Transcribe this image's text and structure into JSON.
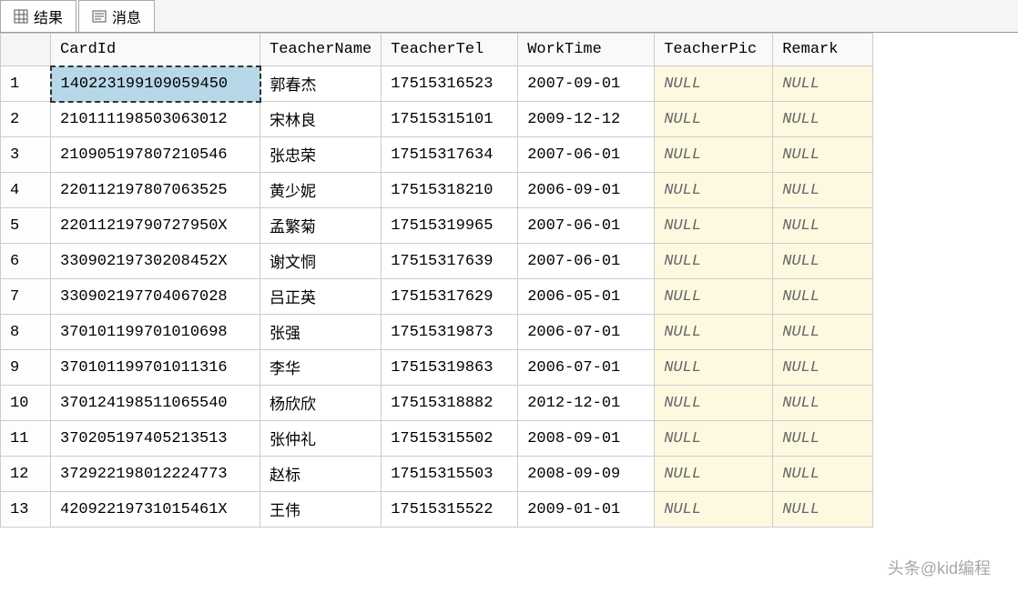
{
  "tabs": {
    "results": "结果",
    "messages": "消息"
  },
  "columns": {
    "cardId": "CardId",
    "teacherName": "TeacherName",
    "teacherTel": "TeacherTel",
    "workTime": "WorkTime",
    "teacherPic": "TeacherPic",
    "remark": "Remark"
  },
  "nullText": "NULL",
  "rows": [
    {
      "num": "1",
      "cardId": "140223199109059450",
      "teacherName": "郭春杰",
      "teacherTel": "17515316523",
      "workTime": "2007-09-01",
      "teacherPic": null,
      "remark": null
    },
    {
      "num": "2",
      "cardId": "210111198503063012",
      "teacherName": "宋林良",
      "teacherTel": "17515315101",
      "workTime": "2009-12-12",
      "teacherPic": null,
      "remark": null
    },
    {
      "num": "3",
      "cardId": "210905197807210546",
      "teacherName": "张忠荣",
      "teacherTel": "17515317634",
      "workTime": "2007-06-01",
      "teacherPic": null,
      "remark": null
    },
    {
      "num": "4",
      "cardId": "220112197807063525",
      "teacherName": "黄少妮",
      "teacherTel": "17515318210",
      "workTime": "2006-09-01",
      "teacherPic": null,
      "remark": null
    },
    {
      "num": "5",
      "cardId": "22011219790727950X",
      "teacherName": "孟繁菊",
      "teacherTel": "17515319965",
      "workTime": "2007-06-01",
      "teacherPic": null,
      "remark": null
    },
    {
      "num": "6",
      "cardId": "33090219730208452X",
      "teacherName": "谢文恫",
      "teacherTel": "17515317639",
      "workTime": "2007-06-01",
      "teacherPic": null,
      "remark": null
    },
    {
      "num": "7",
      "cardId": "330902197704067028",
      "teacherName": "吕正英",
      "teacherTel": "17515317629",
      "workTime": "2006-05-01",
      "teacherPic": null,
      "remark": null
    },
    {
      "num": "8",
      "cardId": "370101199701010698",
      "teacherName": "张强",
      "teacherTel": "17515319873",
      "workTime": "2006-07-01",
      "teacherPic": null,
      "remark": null
    },
    {
      "num": "9",
      "cardId": "370101199701011316",
      "teacherName": "李华",
      "teacherTel": "17515319863",
      "workTime": "2006-07-01",
      "teacherPic": null,
      "remark": null
    },
    {
      "num": "10",
      "cardId": "370124198511065540",
      "teacherName": "杨欣欣",
      "teacherTel": "17515318882",
      "workTime": "2012-12-01",
      "teacherPic": null,
      "remark": null
    },
    {
      "num": "11",
      "cardId": "370205197405213513",
      "teacherName": "张仲礼",
      "teacherTel": "17515315502",
      "workTime": "2008-09-01",
      "teacherPic": null,
      "remark": null
    },
    {
      "num": "12",
      "cardId": "372922198012224773",
      "teacherName": "赵标",
      "teacherTel": "17515315503",
      "workTime": "2008-09-09",
      "teacherPic": null,
      "remark": null
    },
    {
      "num": "13",
      "cardId": "42092219731015461X",
      "teacherName": "王伟",
      "teacherTel": "17515315522",
      "workTime": "2009-01-01",
      "teacherPic": null,
      "remark": null
    }
  ],
  "watermark": "头条@kid编程",
  "selectedCell": {
    "row": 0,
    "col": "cardId"
  }
}
